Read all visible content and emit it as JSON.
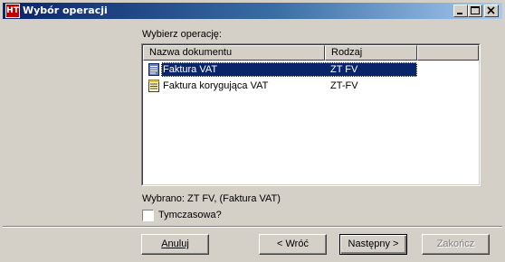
{
  "window": {
    "title": "Wybór operacji",
    "app_icon_text": "HT"
  },
  "list": {
    "label": "Wybierz operację:",
    "columns": [
      "Nazwa dokumentu",
      "Rodzaj"
    ],
    "rows": [
      {
        "name": "Faktura VAT",
        "type": "ZT FV",
        "selected": true
      },
      {
        "name": "Faktura korygująca VAT",
        "type": "ZT-FV",
        "selected": false
      }
    ]
  },
  "selection_info": "Wybrano: ZT FV, (Faktura VAT)",
  "temporary_checkbox": {
    "label": "Tymczasowa?",
    "checked": false
  },
  "buttons": {
    "cancel": "Anuluj",
    "back": "< Wróć",
    "next": "Następny >",
    "finish": "Zakończ"
  },
  "icons": {
    "app": "app-logo-icon",
    "minimize": "minimize-icon",
    "maximize": "maximize-icon",
    "close": "close-icon",
    "row_selected": "document-icon",
    "row": "document-icon"
  },
  "colors": {
    "title_bar_start": "#0a246a",
    "title_bar_end": "#a6caf0",
    "selection": "#0a246a",
    "face": "#d4d0c8"
  }
}
